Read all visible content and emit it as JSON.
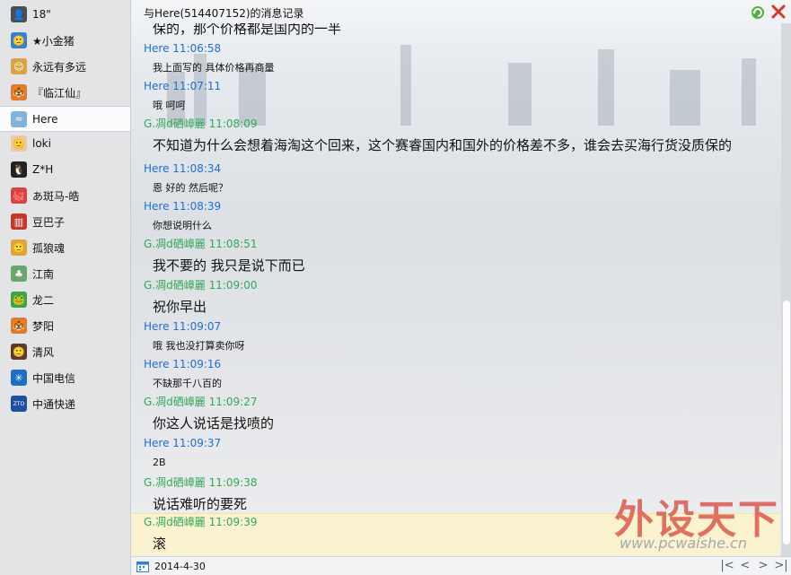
{
  "window": {
    "title": "与Here(514407152)的消息记录"
  },
  "contacts": [
    {
      "name": "18\"",
      "color": "#4a4f55",
      "glyph": "👤"
    },
    {
      "name": "★小金猪",
      "color": "#3b7fd1",
      "glyph": "🙂"
    },
    {
      "name": "永远有多远",
      "color": "#d9a441",
      "glyph": "😊"
    },
    {
      "name": "『临江仙』",
      "color": "#e07a2f",
      "glyph": "🐯"
    },
    {
      "name": "Here",
      "color": "#7fb3d9",
      "glyph": "≈"
    },
    {
      "name": "loki",
      "color": "#f2c6a0",
      "glyph": "🙂"
    },
    {
      "name": "Z*H",
      "color": "#222222",
      "glyph": "🐧"
    },
    {
      "name": "あ斑马-皓",
      "color": "#d94343",
      "glyph": "🐙"
    },
    {
      "name": "豆巴子",
      "color": "#c0392b",
      "glyph": "▥"
    },
    {
      "name": "孤狼魂",
      "color": "#e0a43a",
      "glyph": "🙂"
    },
    {
      "name": "江南",
      "color": "#6aa56b",
      "glyph": "♣"
    },
    {
      "name": "龙二",
      "color": "#3fa34d",
      "glyph": "🐸"
    },
    {
      "name": "梦阳",
      "color": "#e07a2f",
      "glyph": "🐯"
    },
    {
      "name": "清风",
      "color": "#5a3b2e",
      "glyph": "🙂"
    },
    {
      "name": "中国电信",
      "color": "#1e6fc2",
      "glyph": "✳"
    },
    {
      "name": "中通快递",
      "color": "#1e4fa3",
      "glyph": "ZTO"
    }
  ],
  "selected_contact": "Here",
  "messages": [
    {
      "sender": "",
      "time": "",
      "text": "保的，那个价格都是国内的一半",
      "style": "big",
      "partial": true
    },
    {
      "sender": "Here",
      "time": "11:06:58",
      "text": "我上面写的   具体价格再商量",
      "style": "small",
      "color": "blue"
    },
    {
      "sender": "Here",
      "time": "11:07:11",
      "text": "哦   呵呵",
      "style": "small",
      "color": "blue"
    },
    {
      "sender": "G.凋d硒嶂麗",
      "time": "11:08:09",
      "text": "不知道为什么会想着海淘这个回来，这个赛睿国内和国外的价格差不多，谁会去买海行货没质保的",
      "style": "big",
      "color": "green"
    },
    {
      "sender": "Here",
      "time": "11:08:34",
      "text": "恩   好的   然后呢？",
      "style": "small",
      "color": "blue"
    },
    {
      "sender": "Here",
      "time": "11:08:39",
      "text": "你想说明什么",
      "style": "small",
      "color": "blue"
    },
    {
      "sender": "G.凋d硒嶂麗",
      "time": "11:08:51",
      "text": "我不要的 我只是说下而已",
      "style": "big",
      "color": "green"
    },
    {
      "sender": "G.凋d硒嶂麗",
      "time": "11:09:00",
      "text": "祝你早出",
      "style": "big",
      "color": "green"
    },
    {
      "sender": "Here",
      "time": "11:09:07",
      "text": "哦   我也没打算卖你呀",
      "style": "small",
      "color": "blue"
    },
    {
      "sender": "Here",
      "time": "11:09:16",
      "text": "不缺那千八百的",
      "style": "small",
      "color": "blue"
    },
    {
      "sender": "G.凋d硒嶂麗",
      "time": "11:09:27",
      "text": "你这人说话是找喷的",
      "style": "big",
      "color": "green"
    },
    {
      "sender": "Here",
      "time": "11:09:37",
      "text": "2B",
      "style": "small",
      "color": "blue"
    },
    {
      "sender": "G.凋d硒嶂麗",
      "time": "11:09:38",
      "text": "说话难听的要死",
      "style": "big",
      "color": "green"
    },
    {
      "sender": "G.凋d硒嶂麗",
      "time": "11:09:39",
      "text": "滚",
      "style": "big",
      "color": "green"
    }
  ],
  "watermark": {
    "text": "外设天下",
    "url": "www.pcwaishe.cn"
  },
  "footer": {
    "date": "2014-4-30",
    "nav": [
      "|<",
      "<",
      ">",
      ">|"
    ]
  },
  "colors": {
    "blue": "#1d6ed6",
    "green": "#32a85a",
    "highlight": "#fbf3cf"
  }
}
